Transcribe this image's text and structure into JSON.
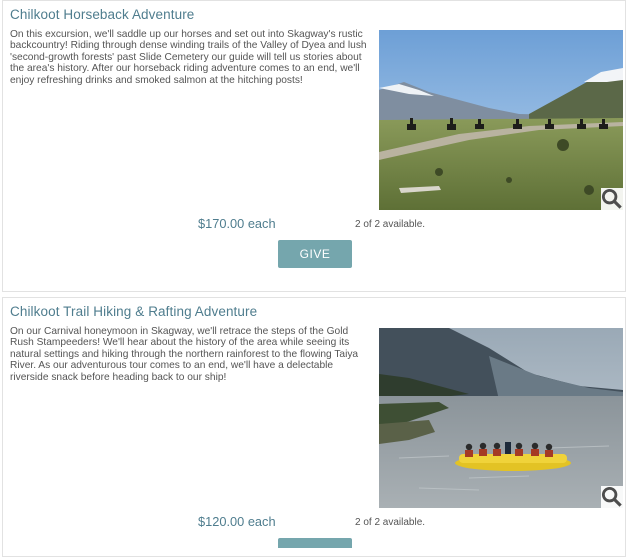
{
  "listings": [
    {
      "title": "Chilkoot Horseback Adventure",
      "description": "On this excursion, we'll saddle up our horses and set out into Skagway's rustic backcountry! Riding through dense winding trails of the Valley of Dyea and lush 'second-growth forests' past Slide Cemetery our guide will tell us stories about the area's history. After our horseback riding adventure comes to an end, we'll enjoy refreshing drinks and smoked salmon at the hitching posts!",
      "price": "$170.00 each",
      "availability": "2 of 2 available.",
      "button_label": "GIVE",
      "icon": "zoom-magnifier-icon"
    },
    {
      "title": "Chilkoot Trail Hiking & Rafting Adventure",
      "description": "On our Carnival honeymoon in Skagway, we'll retrace the steps of the Gold Rush Stampeeders! We'll hear about the history of the area while seeing its natural settings and hiking through the northern rainforest to the flowing Taiya River. As our adventurous tour comes to an end, we'll have a delectable riverside snack before heading back to our ship!",
      "price": "$120.00 each",
      "availability": "2 of 2 available.",
      "icon": "zoom-magnifier-icon"
    }
  ],
  "colors": {
    "accent": "#4f7d8e",
    "button": "#75a6ad",
    "border": "#e2e2e2"
  }
}
